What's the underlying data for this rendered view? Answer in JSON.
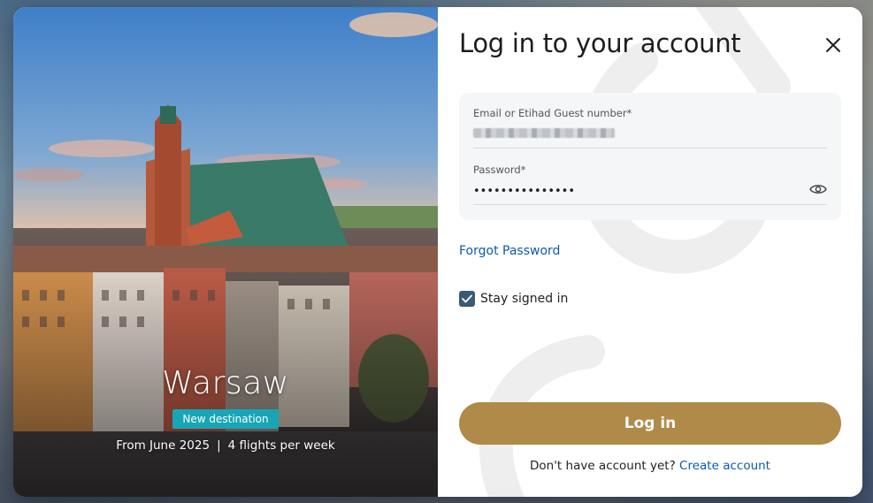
{
  "hero": {
    "city": "Warsaw",
    "badge": "New destination",
    "start": "From June 2025",
    "separator": "|",
    "frequency": "4 flights per week"
  },
  "login": {
    "title": "Log in to your account",
    "email_label": "Email or Etihad Guest number*",
    "password_label": "Password*",
    "password_value": "•••••••••••••••",
    "forgot_link": "Forgot Password",
    "stay_signed_in_label": "Stay signed in",
    "stay_signed_in_checked": true,
    "submit_label": "Log in",
    "signup_prompt": "Don't have account yet?",
    "signup_link": "Create account"
  },
  "icons": {
    "close": "close-icon",
    "password_visibility": "eye-icon",
    "checkbox": "checkmark-icon"
  },
  "colors": {
    "primary_button": "#b08a48",
    "link": "#0e5aa7",
    "badge": "#18a6b6",
    "checkbox": "#3b5a78"
  }
}
